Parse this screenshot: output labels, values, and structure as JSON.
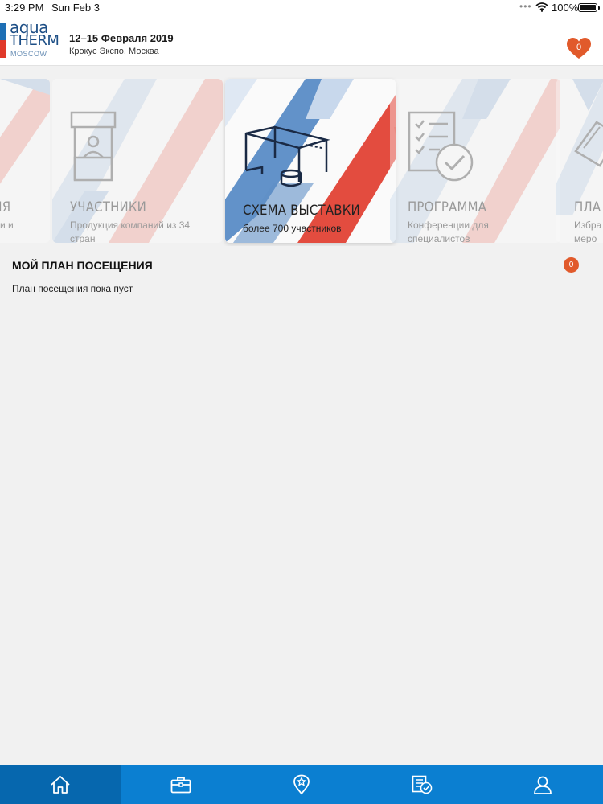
{
  "status_bar": {
    "time": "3:29 PM",
    "date": "Sun Feb 3",
    "battery": "100%"
  },
  "header": {
    "logo_line1": "aqua",
    "logo_line2": "THERM",
    "logo_line3": "MOSCOW",
    "dates": "12–15 Февраля 2019",
    "venue": "Крокус Экспо, Москва",
    "favorites_count": "0"
  },
  "cards": [
    {
      "title": "НИЯ",
      "desc": "и и"
    },
    {
      "title": "УЧАСТНИКИ",
      "desc": "Продукция компаний из 34 стран"
    },
    {
      "title": "СХЕМА ВЫСТАВКИ",
      "desc": "более 700 участников"
    },
    {
      "title": "ПРОГРАММА",
      "desc": "Конференции для специалистов"
    },
    {
      "title": "ПЛА",
      "desc": "Избра меро"
    }
  ],
  "plan": {
    "title": "МОЙ ПЛАН ПОСЕЩЕНИЯ",
    "count": "0",
    "empty_text": "План посещения пока пуст"
  },
  "tabbar": {
    "items": [
      "home-icon",
      "briefcase-icon",
      "star-pin-icon",
      "checklist-icon",
      "profile-icon"
    ],
    "active_index": 0
  },
  "colors": {
    "accent_blue": "#0b7fd1",
    "accent_red": "#e0392a",
    "badge_orange": "#e15a2b"
  }
}
